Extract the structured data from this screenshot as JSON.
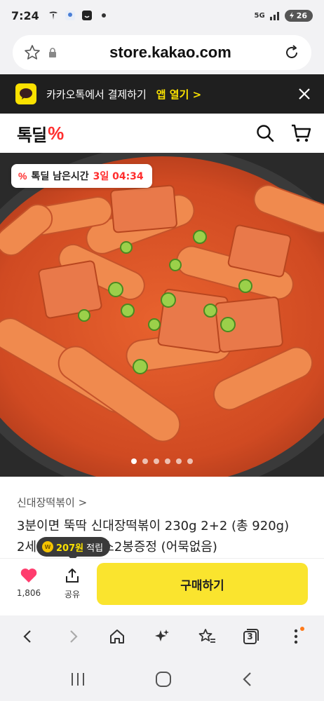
{
  "status_bar": {
    "time": "7:24",
    "network": "5G",
    "battery": "26"
  },
  "url_bar": {
    "url": "store.kakao.com"
  },
  "kakao_banner": {
    "text": "카카오톡에서 결제하기",
    "open_label": "앱 열기 >"
  },
  "header": {
    "brand": "톡딜",
    "brand_mark": "%"
  },
  "product_image": {
    "timer_mark": "%",
    "timer_label": "톡딜 남은시간",
    "timer_value": "3일 04:34",
    "slides_total": 6,
    "slide_active": 1
  },
  "product": {
    "category": "신대장떡볶이 >",
    "title_line1": "3분이면 뚝딱 신대장떡볶이 230g 2+2 (총 920g)",
    "title_line2": "2세트 구매시 소스2봉증정 (어묵없음)"
  },
  "reward": {
    "coin_label": "W",
    "amount": "207원",
    "suffix": "적립"
  },
  "purchase_bar": {
    "like_count": "1,806",
    "share_label": "공유",
    "buy_label": "구매하기"
  },
  "browser_toolbar": {
    "tab_count": "3"
  },
  "colors": {
    "kakao_yellow": "#fae100",
    "brand_red": "#ff2e2e",
    "buy_button": "#fae42e",
    "like_heart": "#ff3d6e"
  }
}
